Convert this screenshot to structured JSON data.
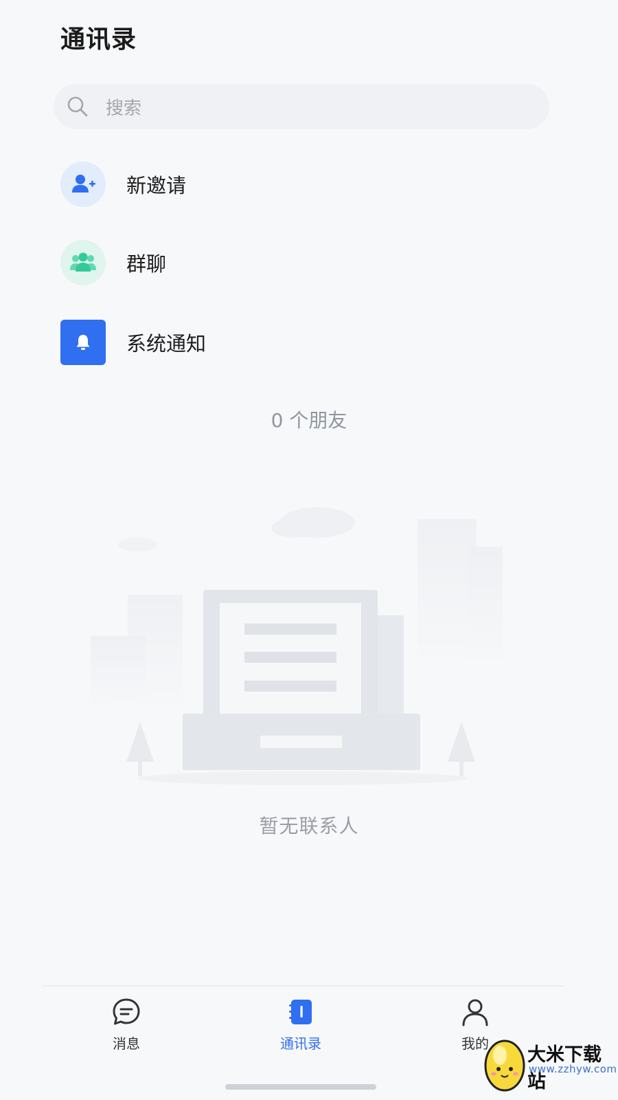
{
  "header": {
    "title": "通讯录"
  },
  "search": {
    "placeholder": "搜索",
    "icon": "search-icon"
  },
  "entries": [
    {
      "label": "新邀请",
      "icon": "add-user-icon",
      "color": "#2f6ff0",
      "bg": "#e3ecfb"
    },
    {
      "label": "群聊",
      "icon": "group-icon",
      "color": "#35c99a",
      "bg": "#dff5ee"
    },
    {
      "label": "系统通知",
      "icon": "bell-icon",
      "color": "#ffffff",
      "bg": "#2f6ff0"
    }
  ],
  "friend_count": "0 个朋友",
  "empty_state": {
    "text": "暂无联系人"
  },
  "tabbar": {
    "tabs": [
      {
        "label": "消息",
        "icon": "message-icon",
        "active": false
      },
      {
        "label": "通讯录",
        "icon": "contacts-icon",
        "active": true
      },
      {
        "label": "我的",
        "icon": "profile-icon",
        "active": false
      }
    ]
  },
  "watermark": {
    "title": "大米下载站",
    "url": "www.zzhyw.com"
  },
  "colors": {
    "accent": "#2f6ff0",
    "background": "#f7f8fa"
  }
}
